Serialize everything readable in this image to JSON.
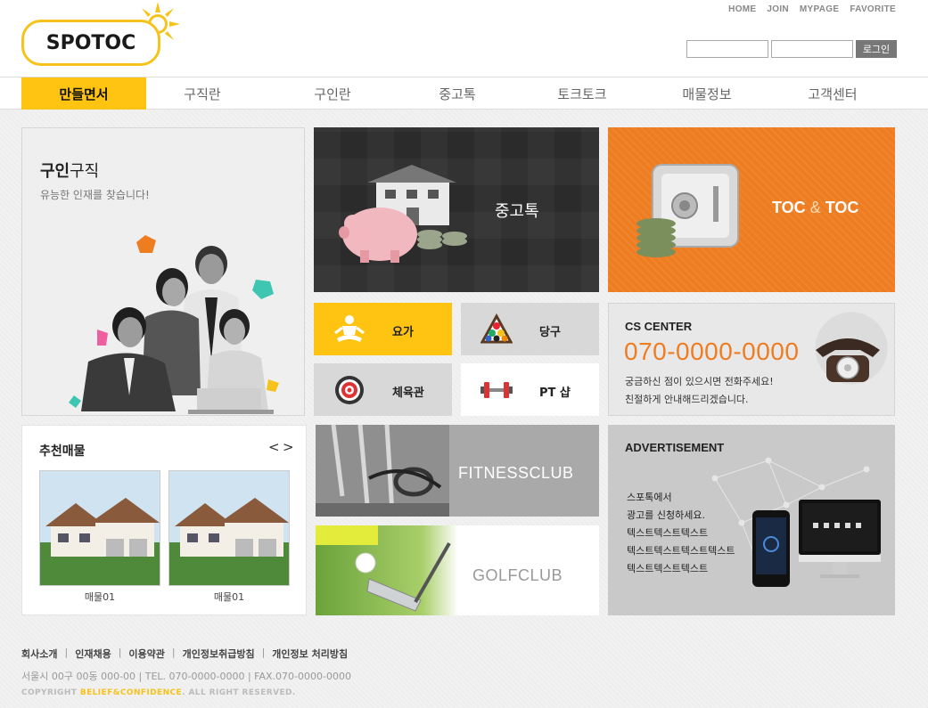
{
  "header": {
    "logo_text": "SPOTOC",
    "top_links": [
      "HOME",
      "JOIN",
      "MYPAGE",
      "FAVORITE"
    ],
    "login_button": "로그인"
  },
  "nav": {
    "items": [
      "만들면서",
      "구직란",
      "구인란",
      "중고톡",
      "토크토크",
      "매물정보",
      "고객센터"
    ],
    "active_index": 0
  },
  "people_tile": {
    "title_bold": "구인",
    "title_rest": "구직",
    "subtitle": "유능한 인재를 찾습니다!"
  },
  "used_tile": {
    "label": "중고톡"
  },
  "toc_tile": {
    "label_left": "TOC",
    "label_amp": "&",
    "label_right": "TOC"
  },
  "small_tiles": [
    {
      "label": "요가",
      "icon": "yoga-icon"
    },
    {
      "label": "당구",
      "icon": "billiard-icon"
    },
    {
      "label": "체육관",
      "icon": "target-icon"
    },
    {
      "label": "PT 샵",
      "icon": "dumbbell-icon"
    }
  ],
  "cs": {
    "heading": "CS CENTER",
    "phone": "070-0000-0000",
    "line1": "궁금하신 점이 있으시면 전화주세요!",
    "line2": "친절하게 안내해드리겠습니다."
  },
  "recommend": {
    "heading": "추천매물",
    "prev": "<",
    "next": ">",
    "items": [
      "매물01",
      "매물01"
    ]
  },
  "fitness": {
    "label": "FITNESSCLUB"
  },
  "golf": {
    "label": "GOLFCLUB"
  },
  "ad": {
    "heading": "ADVERTISEMENT",
    "lines": [
      "스포톡에서",
      "광고를 신청하세요.",
      "텍스트텍스트텍스트",
      "텍스트텍스트텍스트텍스트",
      "텍스트텍스트텍스트"
    ]
  },
  "footer": {
    "links": [
      "회사소개",
      "인재채용",
      "이용약관",
      "개인정보취급방침",
      "개인정보 처리방침"
    ],
    "address": "서울시 00구 00동 000-00  |  TEL. 070-0000-0000  |  FAX.070-0000-0000",
    "copyright_prefix": "COPYRIGHT",
    "copyright_brand": "BELIEF&CONFIDENCE",
    "copyright_suffix": ". ALL RIGHT RESERVED."
  },
  "colors": {
    "brand_yellow": "#ffc411",
    "orange": "#ee7d22",
    "dark": "#2b2b2b"
  }
}
